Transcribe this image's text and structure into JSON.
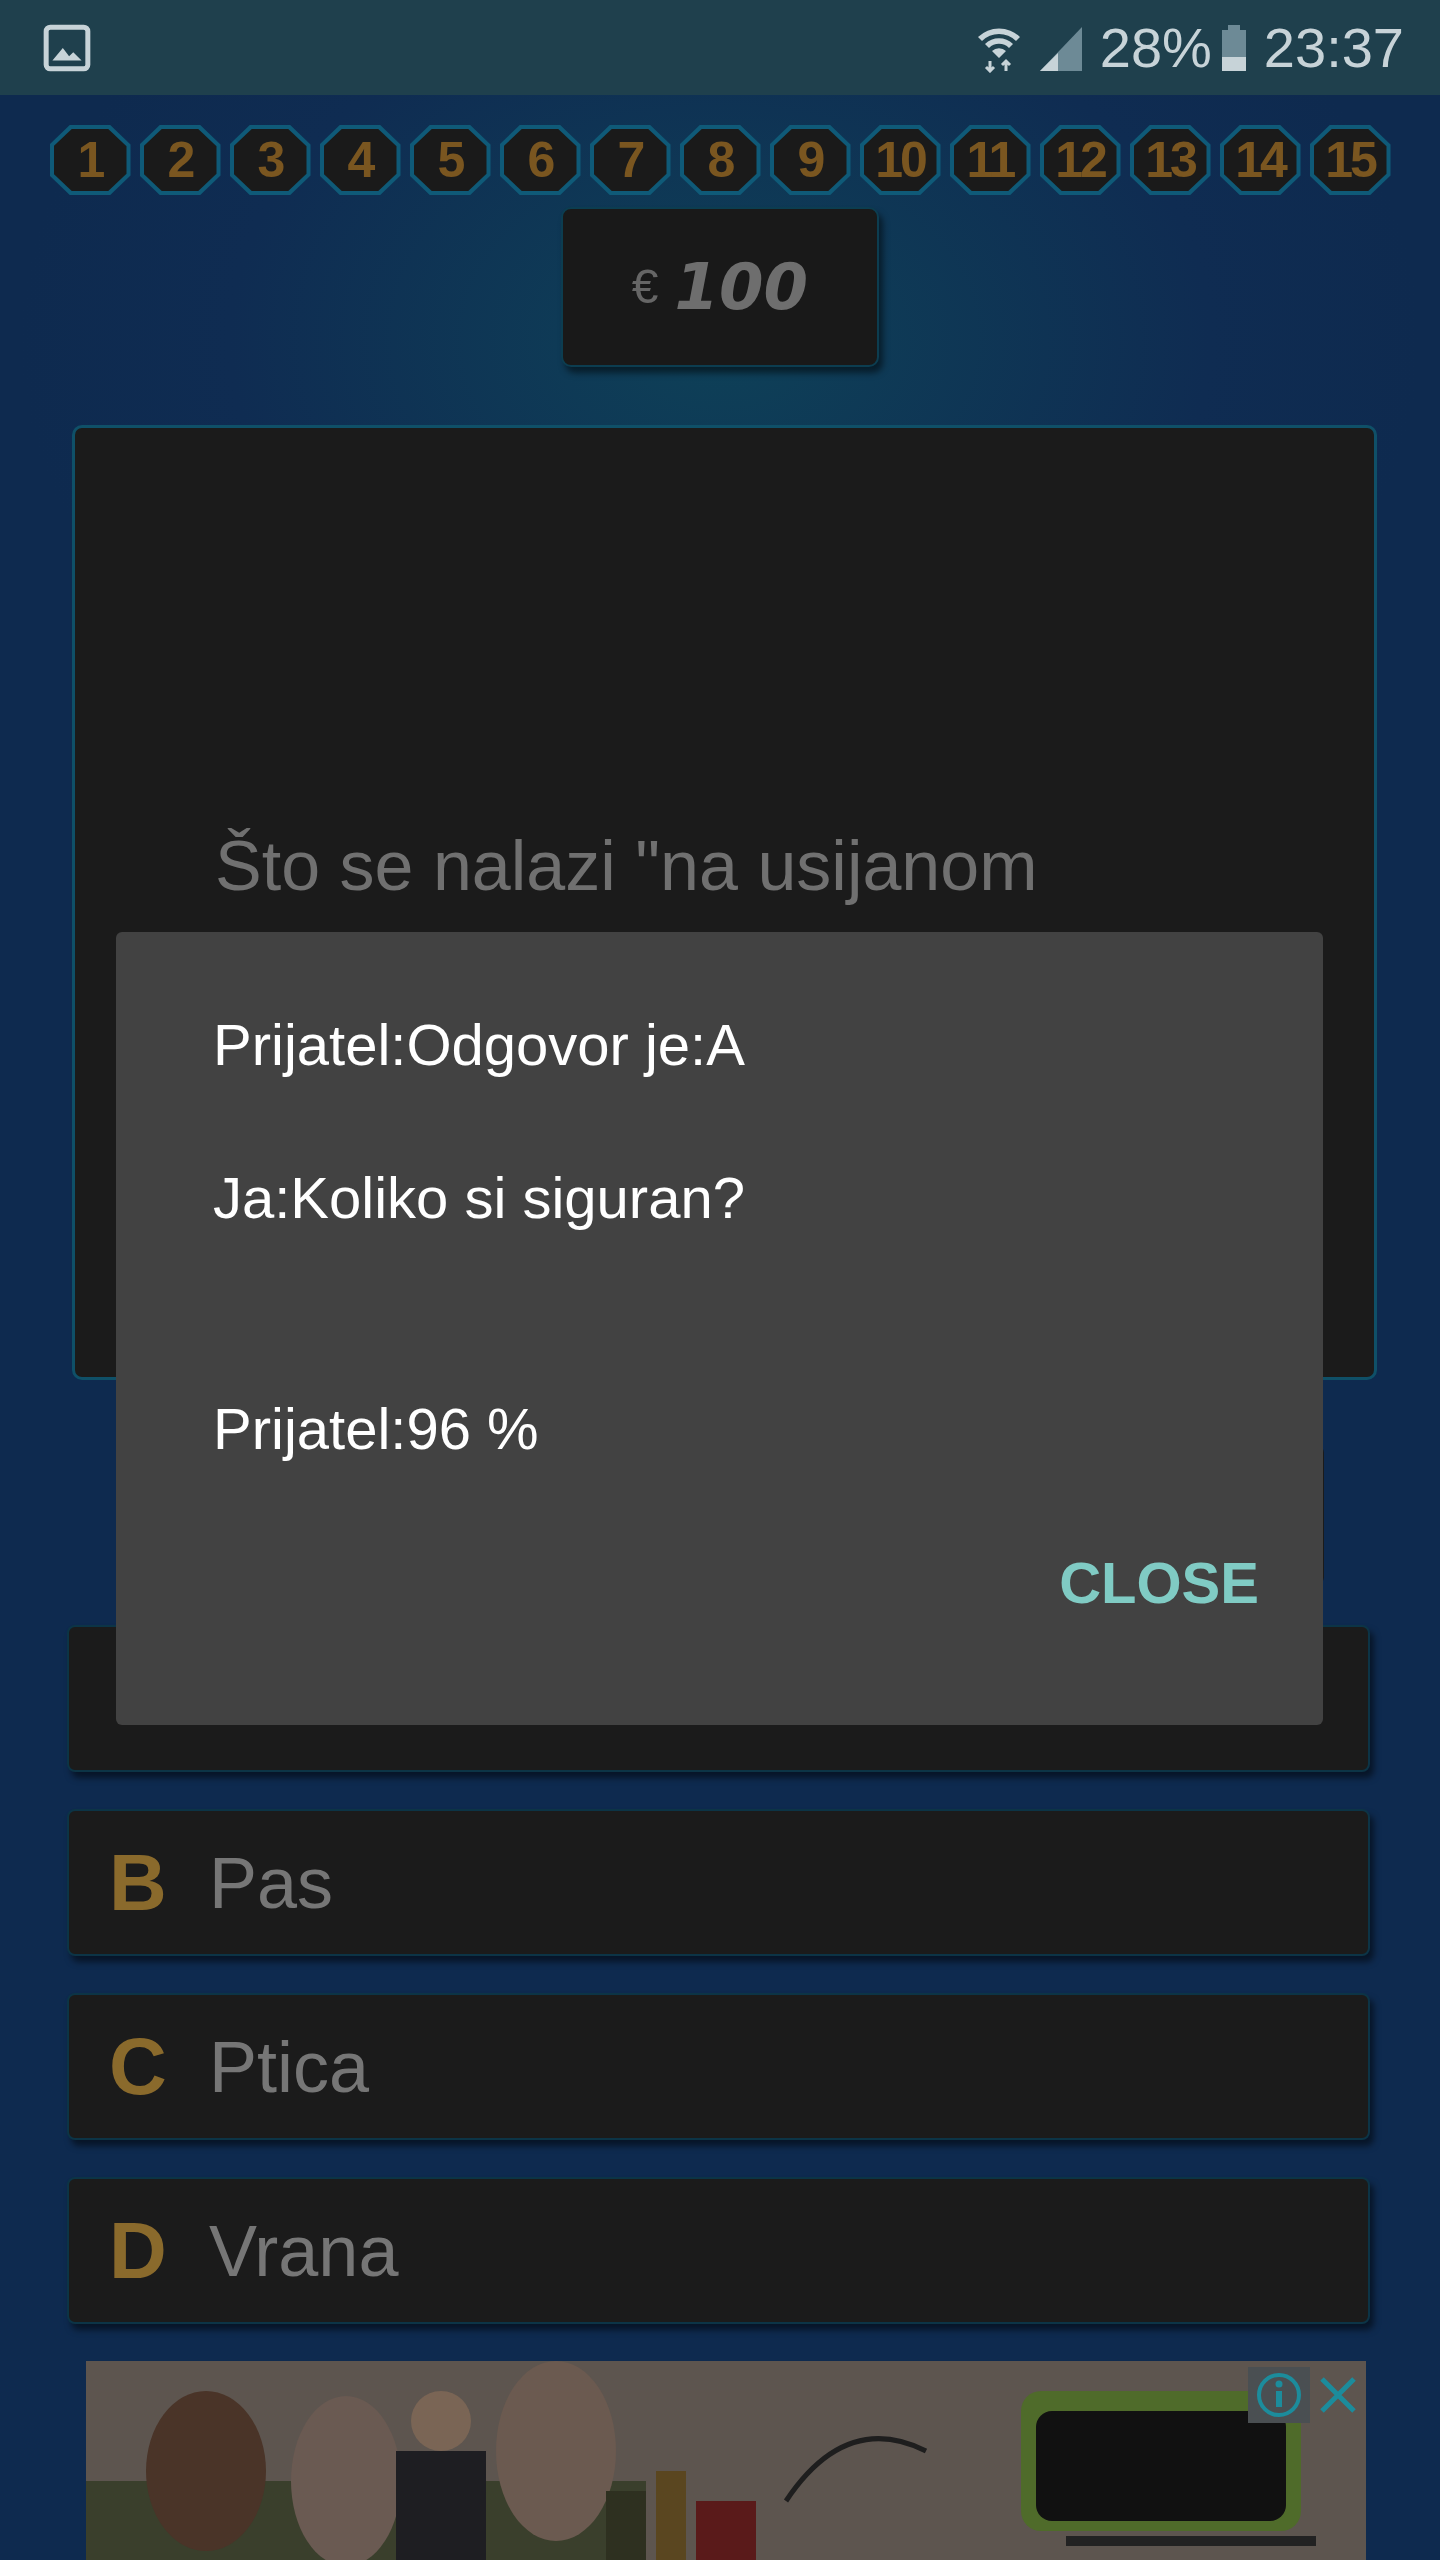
{
  "status_bar": {
    "battery": "28%",
    "time": "23:37"
  },
  "levels": [
    "1",
    "2",
    "3",
    "4",
    "5",
    "6",
    "7",
    "8",
    "9",
    "10",
    "11",
    "12",
    "13",
    "14",
    "15"
  ],
  "prize": {
    "currency": "€",
    "amount": "100"
  },
  "question": "Što se nalazi \"na usijanom",
  "answers": [
    {
      "letter": "B",
      "text": "Pas"
    },
    {
      "letter": "C",
      "text": "Ptica"
    },
    {
      "letter": "D",
      "text": "Vrana"
    }
  ],
  "dialog": {
    "lines": [
      "Prijatel:Odgovor je:A",
      "Ja:Koliko si siguran?",
      "Prijatel:96 %"
    ],
    "button": "CLOSE"
  }
}
